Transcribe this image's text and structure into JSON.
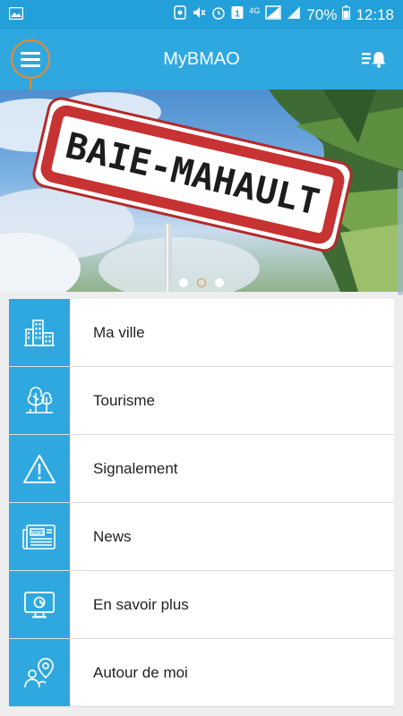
{
  "status_bar": {
    "battery": "70%",
    "time": "12:18",
    "network": "4G"
  },
  "app_bar": {
    "title": "MyBMAO"
  },
  "hero": {
    "sign_text": "BAIE-MAHAULT",
    "slides": 3,
    "active_slide": 2
  },
  "menu": [
    {
      "label": "Ma ville",
      "icon": "city-buildings-icon"
    },
    {
      "label": "Tourisme",
      "icon": "trees-icon"
    },
    {
      "label": "Signalement",
      "icon": "warning-triangle-icon"
    },
    {
      "label": "News",
      "icon": "newspaper-icon"
    },
    {
      "label": "En savoir plus",
      "icon": "monitor-info-icon"
    },
    {
      "label": "Autour de moi",
      "icon": "location-people-icon"
    }
  ],
  "colors": {
    "primary": "#2fa8e0",
    "status_bar": "#239fd9",
    "accent": "#f08a2b"
  }
}
